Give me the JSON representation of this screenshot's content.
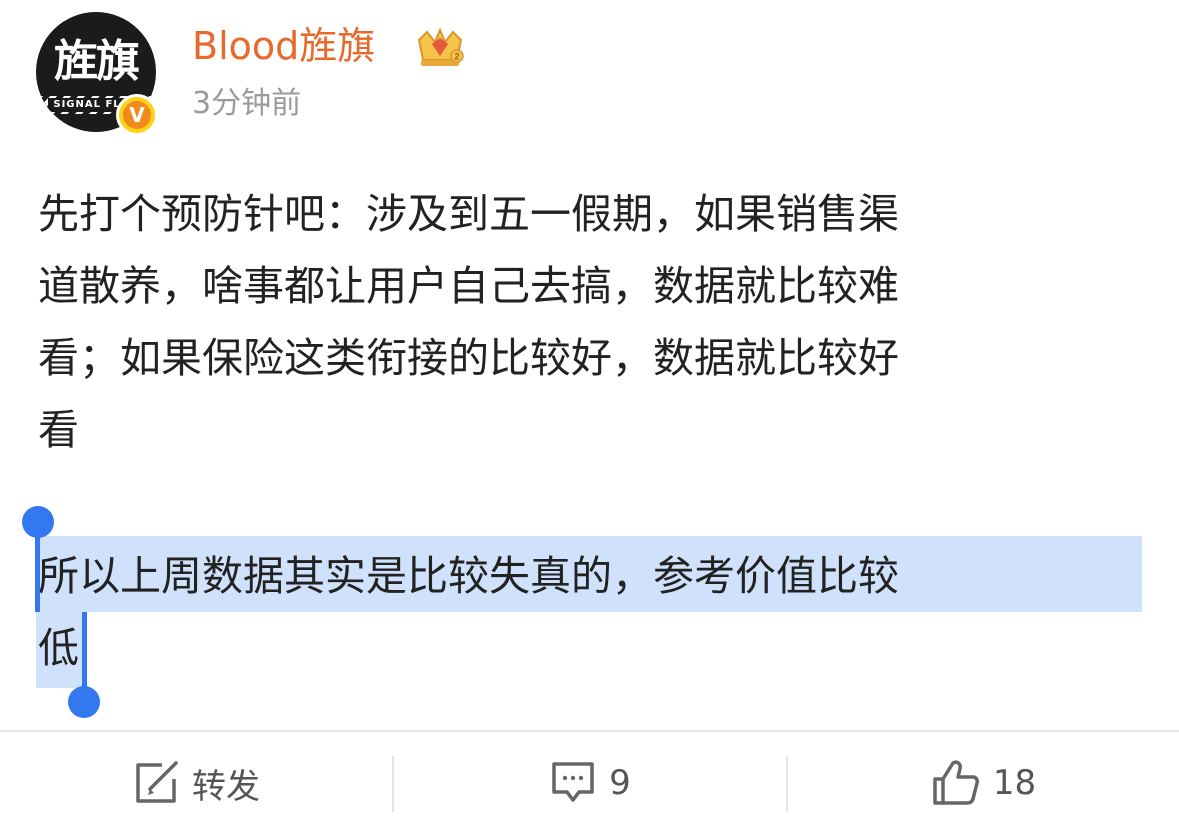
{
  "user": {
    "name": "Blood旌旗",
    "avatar_text": "旌旗",
    "avatar_subtext": "SIGNAL FLAG",
    "verified_badge": "V",
    "timestamp": "3分钟前"
  },
  "post": {
    "lines": [
      "先打个预防针吧：涉及到五一假期，如果销售渠",
      "道散养，啥事都让用户自己去搞，数据就比较难",
      "看；如果保险这类衔接的比较好，数据就比较好",
      "看"
    ],
    "selected_lines": [
      "所以上周数据其实是比较失真的，参考价值比较",
      "低"
    ]
  },
  "actions": {
    "repost_label": "转发",
    "comment_count": "9",
    "like_count": "18"
  },
  "colors": {
    "username": "#e8692c",
    "selection": "#d0e1fb",
    "handle": "#3478f0"
  }
}
